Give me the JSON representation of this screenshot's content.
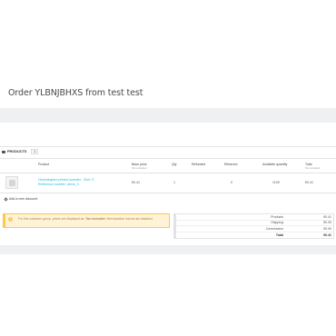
{
  "page": {
    "title": "Order YLBNJBHXS from test test"
  },
  "products_panel": {
    "heading": "PRODUCTS",
    "count": "1",
    "columns": [
      {
        "label": "Product",
        "sub": ""
      },
      {
        "label": "Base price",
        "sub": "Tax excluded"
      },
      {
        "label": "Qty",
        "sub": ""
      },
      {
        "label": "Refunded",
        "sub": ""
      },
      {
        "label": "Returned",
        "sub": ""
      },
      {
        "label": "Available quantity",
        "sub": ""
      },
      {
        "label": "Total",
        "sub": "Tax excluded"
      }
    ],
    "rows": [
      {
        "name_line1": "Hummingbird printed sweater - Size: S",
        "name_line2": "Reference number: demo_3",
        "base_price": "€0.41",
        "qty": "1",
        "refunded": "",
        "returned": "0",
        "available": "1199",
        "total": "€0.41"
      }
    ],
    "add_discount": "Add a new discount",
    "warning_text_1": "For this customer group, prices are displayed as: ",
    "warning_text_bold": "Tax excluded",
    "warning_text_2": ". Merchandise returns are disabled",
    "totals": [
      {
        "label": "Products",
        "value": "€0.41"
      },
      {
        "label": "Shipping",
        "value": "€0.00"
      },
      {
        "label": "Commission",
        "value": "€0.00"
      },
      {
        "label": "Total",
        "value": "€0.41"
      }
    ]
  }
}
